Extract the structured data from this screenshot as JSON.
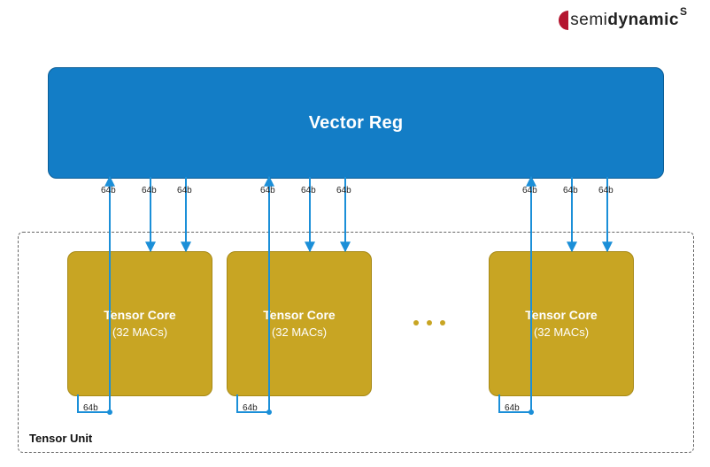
{
  "brand": {
    "semi": "semi",
    "dynamic": "dynamic",
    "suffix": "S"
  },
  "vector_reg": {
    "title": "Vector Reg"
  },
  "tensor_unit": {
    "label": "Tensor Unit"
  },
  "bus_label": "64b",
  "cores": [
    {
      "title": "Tensor Core",
      "sub": "(32 MACs)",
      "out_label": "64b"
    },
    {
      "title": "Tensor Core",
      "sub": "(32 MACs)",
      "out_label": "64b"
    },
    {
      "title": "Tensor Core",
      "sub": "(32 MACs)",
      "out_label": "64b"
    }
  ],
  "ellipsis": "..."
}
